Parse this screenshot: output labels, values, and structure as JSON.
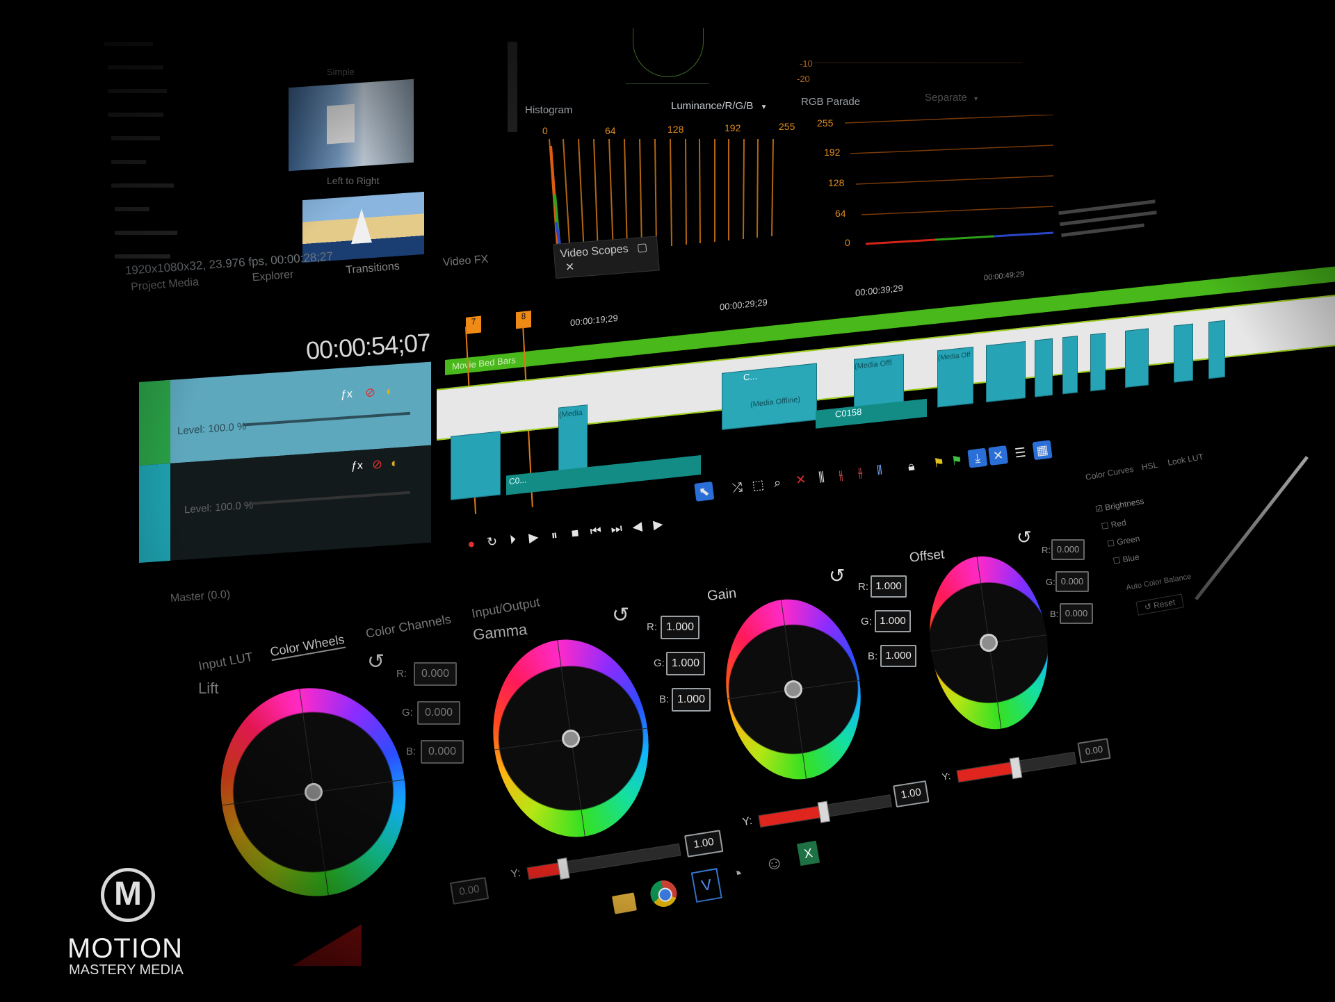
{
  "browser": {
    "transitions_list": [
      "Simple",
      "Left to Right"
    ],
    "media_info": "1920x1080x32, 23.976 fps, 00:00:28;27"
  },
  "tabs": {
    "upper": [
      "Project Media",
      "Explorer",
      "Transitions",
      "Video FX",
      "Video Scopes"
    ]
  },
  "scopes": {
    "histogram_label": "Histogram",
    "luminance_dropdown": "Luminance/R/G/B",
    "histogram_ticks": [
      "0",
      "64",
      "128",
      "192",
      "255"
    ],
    "rgb_parade_label": "RGB Parade",
    "parade_mode": "Separate",
    "parade_ticks": [
      "255",
      "192",
      "128",
      "64",
      "0"
    ],
    "vectorscope_ticks": [
      "-10",
      "-20"
    ]
  },
  "timeline": {
    "timecode": "00:00:54;07",
    "ruler": [
      "00:00:19;29",
      "00:00:29;29",
      "00:00:39;29",
      "00:00:49;29"
    ],
    "markers": [
      "7",
      "8"
    ],
    "region_label": "Movie Bed Bars",
    "clip_labels": [
      "C...",
      "(Media",
      "(Media Offline)",
      "(Media Offl",
      "(Media Off",
      "C0158",
      "C0..."
    ],
    "track_levels": [
      "Level: 100.0 %",
      "Level: 100.0 %"
    ],
    "master": "Master (0.0)"
  },
  "color_grading": {
    "tabs": [
      "Input LUT",
      "Color Wheels",
      "Color Channels",
      "Input/Output"
    ],
    "lift": {
      "label": "Lift",
      "r": "0.000",
      "g": "0.000",
      "b": "0.000",
      "y": "0.00"
    },
    "gamma": {
      "label": "Gamma",
      "r": "1.000",
      "g": "1.000",
      "b": "1.000",
      "y": "1.00"
    },
    "gain": {
      "label": "Gain",
      "r": "1.000",
      "g": "1.000",
      "b": "1.000",
      "y": "1.00"
    },
    "offset": {
      "label": "Offset",
      "r": "0.000",
      "g": "0.000",
      "b": "0.000",
      "y": "0.00"
    },
    "channel_labels": {
      "r": "R:",
      "g": "G:",
      "b": "B:",
      "y": "Y:"
    },
    "curves_tabs": [
      "Color Curves",
      "HSL",
      "Look LUT"
    ],
    "curve_channels": [
      "Brightness",
      "Red",
      "Green",
      "Blue"
    ],
    "auto_color": "Auto Color Balance",
    "reset": "Reset"
  },
  "logo": {
    "line1": "MOTION",
    "line2": "MASTERY MEDIA",
    "mark": "M"
  },
  "colors": {
    "accent_green": "#4fbf1a",
    "clip_teal": "#26a3b5",
    "red_slider": "#e0241e",
    "orange_marker": "#f08a16"
  }
}
